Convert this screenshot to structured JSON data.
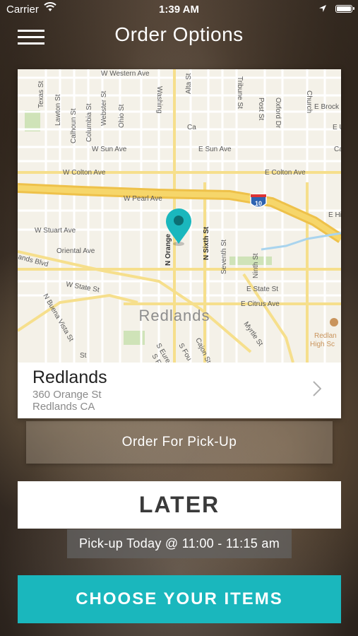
{
  "status_bar": {
    "carrier": "Carrier",
    "time": "1:39 AM"
  },
  "nav": {
    "title": "Order Options",
    "menu_icon": "hamburger-menu-icon"
  },
  "map": {
    "streets": [
      "W Western Ave",
      "Washing",
      "Tribune St",
      "Post St",
      "Oxford Dr",
      "Church",
      "Texas St",
      "Lawton St",
      "Calhoun St",
      "Columbia St",
      "Webster St",
      "Ohio St",
      "Alta St",
      "E Brock",
      "E Union Ave",
      "Ca",
      "W Sun Ave",
      "E Sun Ave",
      "Ca",
      "W Colton Ave",
      "E Colton Ave",
      "W Pearl Ave",
      "E Hi",
      "W Stuart Ave",
      "N Orange",
      "N Sixth St",
      "Seventh St",
      "Ninth St",
      "Oriental Ave",
      "ands Blvd",
      "W State St",
      "E State St",
      "E Citrus Ave",
      "N Buena Vista St",
      "Myrtle St",
      "Cajon St",
      "S Eure",
      "S Fou",
      "S F",
      "St"
    ],
    "city_label": "Redlands",
    "poi_label_line1": "Redlan",
    "poi_label_line2": "High Sc",
    "highway_shield": "10",
    "pin_color": "#1ab7bd"
  },
  "store": {
    "name": "Redlands",
    "address": "360 Orange St",
    "city": "Redlands CA"
  },
  "order_type": {
    "label": "Order For Pick-Up"
  },
  "timing": {
    "later_label": "LATER",
    "pickup_time": "Pick-up Today @ 11:00 - 11:15 am"
  },
  "cta": {
    "label": "CHOOSE YOUR ITEMS",
    "color": "#1ab7bd"
  }
}
